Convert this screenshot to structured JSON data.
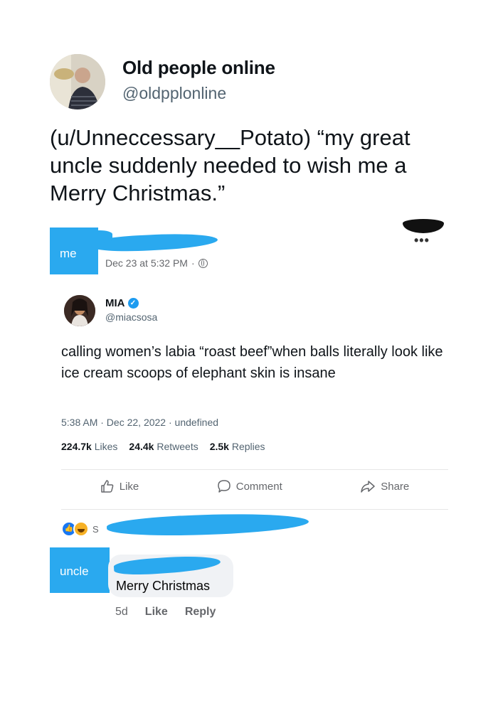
{
  "author": {
    "name": "Old people online",
    "handle": "@oldpplonline"
  },
  "tweet_text": "(u/Unneccessary__Potato) “my great uncle suddenly needed to wish me a Merry Christmas.”",
  "fb_post": {
    "poster_label": "me",
    "date": "Dec 23 at 5:32 PM",
    "date_sep": "·",
    "menu": "•••",
    "embedded_tweet": {
      "name": "MIA",
      "handle": "@miacsosa",
      "text": "calling women’s labia “roast beef”when balls literally look like ice cream scoops of elephant skin is insane",
      "meta": "5:38 AM · Dec 22, 2022 · undefined",
      "stats": [
        {
          "value": "224.7k",
          "label": "Likes"
        },
        {
          "value": "24.4k",
          "label": "Retweets"
        },
        {
          "value": "2.5k",
          "label": "Replies"
        }
      ]
    },
    "actions": {
      "like": "Like",
      "comment": "Comment",
      "share": "Share"
    },
    "reactions_prefix": "S"
  },
  "comment": {
    "author_label": "uncle",
    "text": "Merry Christmas",
    "age": "5d",
    "like": "Like",
    "reply": "Reply"
  }
}
